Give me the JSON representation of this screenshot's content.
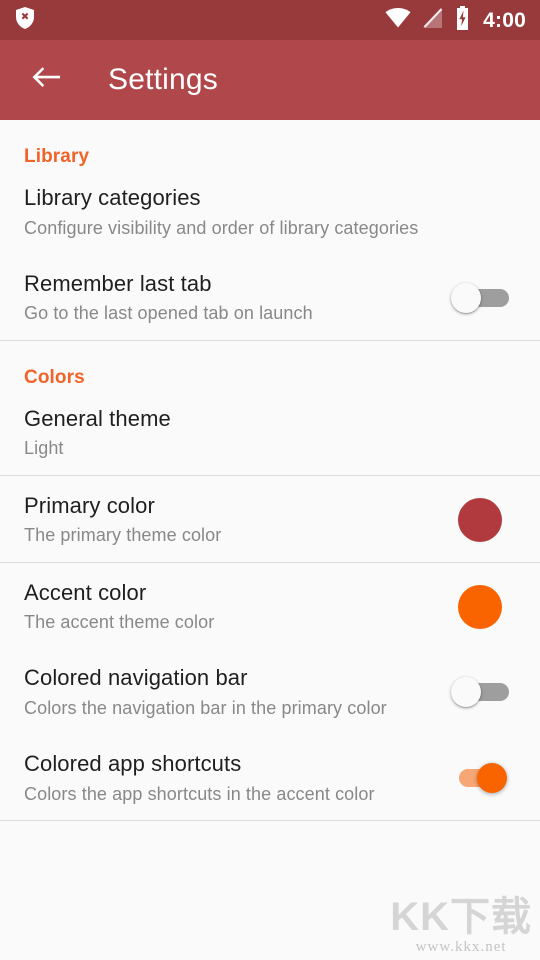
{
  "status_bar": {
    "time": "4:00",
    "icons": [
      "shield-x-icon",
      "wifi-icon",
      "signal-off-icon",
      "battery-charging-icon"
    ],
    "background_color": "#983A3C"
  },
  "toolbar": {
    "title": "Settings",
    "back_icon": "arrow-back-icon",
    "background_color": "#B0474A"
  },
  "sections": [
    {
      "header": "Library",
      "items": [
        {
          "title": "Library categories",
          "summary": "Configure visibility and order of library categories",
          "widget": "none"
        },
        {
          "title": "Remember last tab",
          "summary": "Go to the last opened tab on launch",
          "widget": "switch",
          "switch_state": "off"
        }
      ]
    },
    {
      "header": "Colors",
      "items": [
        {
          "title": "General theme",
          "summary": "Light",
          "widget": "none"
        },
        {
          "title": "Primary color",
          "summary": "The primary theme color",
          "widget": "swatch",
          "swatch_color": "#B03A3E"
        },
        {
          "title": "Accent color",
          "summary": "The accent theme color",
          "widget": "swatch",
          "swatch_color": "#F96300"
        },
        {
          "title": "Colored navigation bar",
          "summary": "Colors the navigation bar in the primary color",
          "widget": "switch",
          "switch_state": "off"
        },
        {
          "title": "Colored app shortcuts",
          "summary": "Colors the app shortcuts in the accent color",
          "widget": "switch",
          "switch_state": "on"
        }
      ]
    }
  ],
  "theme": {
    "section_header_color": "#F0642A",
    "accent_color": "#F96300",
    "primary_color": "#B03A3E",
    "background_color": "#FAFAFA",
    "divider_color": "#DCDCDC"
  },
  "watermark": {
    "main": "KK下载",
    "sub": "www.kkx.net"
  }
}
